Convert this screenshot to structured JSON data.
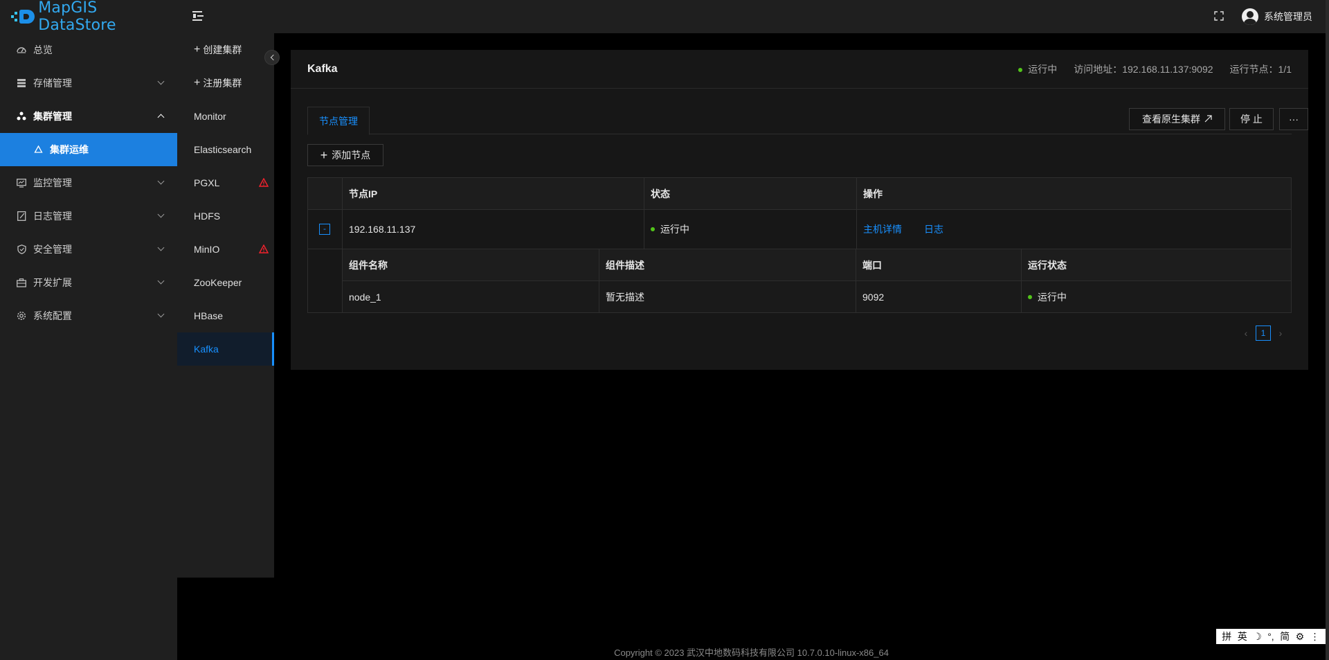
{
  "app": {
    "logo_text": "MapGIS DataStore"
  },
  "sidebar": {
    "items": [
      {
        "label": "总览",
        "icon": "dashboard-icon"
      },
      {
        "label": "存储管理",
        "icon": "storage-icon"
      },
      {
        "label": "集群管理",
        "icon": "cluster-icon"
      },
      {
        "label": "集群运维",
        "icon": "recycle-icon"
      },
      {
        "label": "监控管理",
        "icon": "monitor-icon"
      },
      {
        "label": "日志管理",
        "icon": "log-icon"
      },
      {
        "label": "安全管理",
        "icon": "shield-icon"
      },
      {
        "label": "开发扩展",
        "icon": "toolbox-icon"
      },
      {
        "label": "系统配置",
        "icon": "gear-icon"
      }
    ]
  },
  "topbar": {
    "username": "系统管理员"
  },
  "clusters": {
    "create_label": "创建集群",
    "register_label": "注册集群",
    "items": [
      "Monitor",
      "Elasticsearch",
      "PGXL",
      "HDFS",
      "MinIO",
      "ZooKeeper",
      "HBase",
      "Kafka"
    ],
    "warnings": [
      "PGXL",
      "MinIO"
    ],
    "selected": "Kafka"
  },
  "card": {
    "title": "Kafka",
    "status": "运行中",
    "address_label": "访问地址：",
    "address_value": "192.168.11.137:9092",
    "nodes_label": "运行节点：",
    "nodes_value": "1/1",
    "tab_label": "节点管理",
    "view_native_label": "查看原生集群",
    "stop_label": "停 止",
    "more_label": "···",
    "add_node_label": "添加节点"
  },
  "node_table": {
    "headers": [
      "节点IP",
      "状态",
      "操作"
    ],
    "rows": [
      {
        "ip": "192.168.11.137",
        "status": "运行中",
        "action_detail": "主机详情",
        "action_log": "日志",
        "expand_symbol": "-"
      }
    ]
  },
  "component_table": {
    "headers": [
      "组件名称",
      "组件描述",
      "端口",
      "运行状态"
    ],
    "rows": [
      {
        "name": "node_1",
        "desc": "暂无描述",
        "port": "9092",
        "status": "运行中"
      }
    ]
  },
  "pagination": {
    "current": "1",
    "prev": "‹",
    "next": "›"
  },
  "footer": {
    "copyright": "Copyright © 2023 武汉中地数码科技有限公司 10.7.0.10-linux-x86_64"
  },
  "ime": {
    "items": [
      "拼",
      "英",
      "☽",
      "°,",
      "简",
      "⚙",
      "⋮"
    ]
  },
  "colors": {
    "accent": "#1890ff",
    "running": "#52c41a",
    "warning": "#f5222d",
    "sidebar_bg": "#1f1f1f",
    "active_menu": "#1c80e0"
  }
}
